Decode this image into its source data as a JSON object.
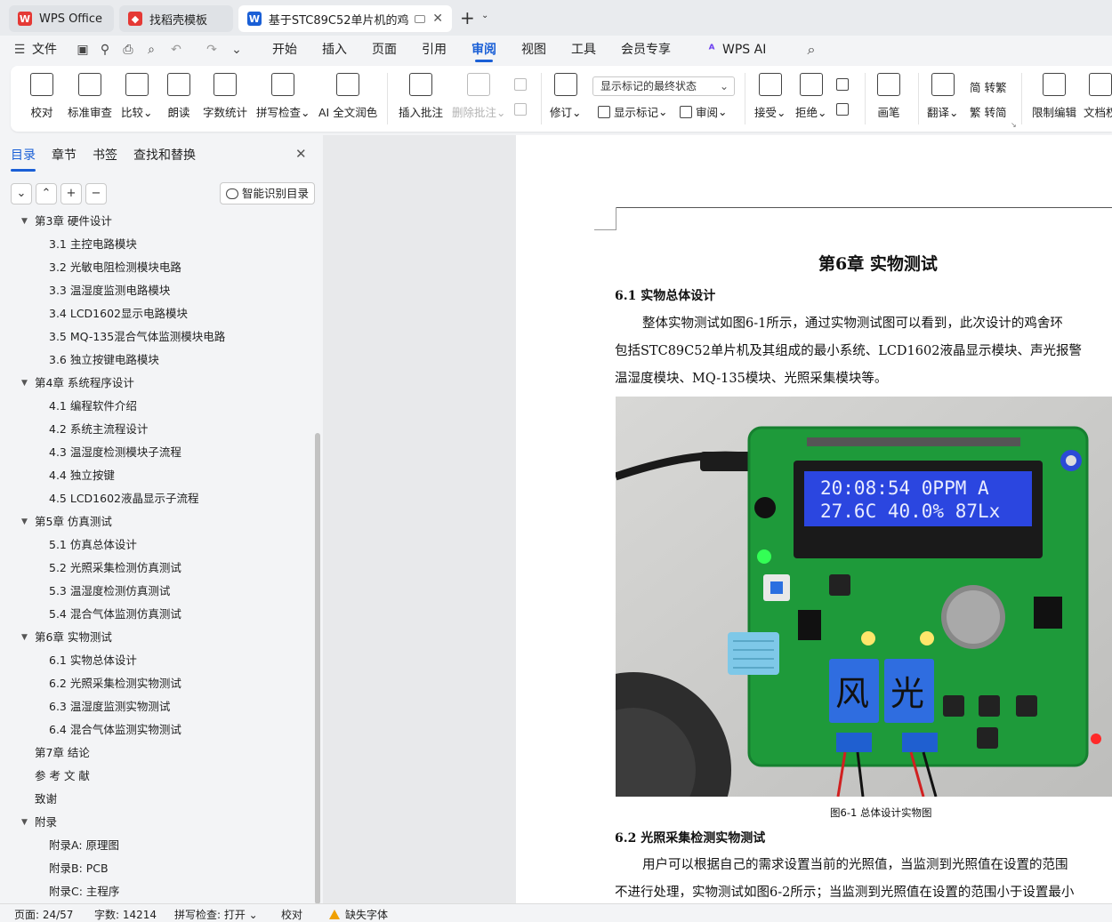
{
  "tabs": [
    {
      "label": "WPS Office",
      "logo": "W",
      "logo_color": "#e53935"
    },
    {
      "label": "找稻壳模板",
      "logo": "稻",
      "logo_color": "#e53935"
    },
    {
      "label": "基于STC89C52单片机的鸡舍环",
      "logo": "W",
      "logo_color": "#1a5fd6"
    }
  ],
  "menubar": {
    "file": "文件",
    "items": [
      "开始",
      "插入",
      "页面",
      "引用",
      "审阅",
      "视图",
      "工具",
      "会员专享",
      "WPS AI"
    ],
    "active": "审阅"
  },
  "ribbon": {
    "proofread": "校对",
    "standard_review": "标准审查",
    "compare": "比较",
    "read_aloud": "朗读",
    "word_count": "字数统计",
    "spell_check": "拼写检查",
    "ai_polish": "AI 全文润色",
    "insert_comment": "插入批注",
    "delete_comment": "删除批注",
    "track_changes": "修订",
    "markup_mode": "显示标记的最终状态",
    "show_markup": "显示标记",
    "review": "审阅",
    "accept": "接受",
    "reject": "拒绝",
    "pen": "画笔",
    "translate": "翻译",
    "to_traditional": "简 转繁",
    "to_simplified": "繁 转简",
    "restrict_edit": "限制编辑",
    "doc_permission": "文档权"
  },
  "nav": {
    "tabs": [
      "目录",
      "章节",
      "书签",
      "查找和替换"
    ],
    "active_tab": "目录",
    "smart_toc": "智能识别目录",
    "items": [
      {
        "text": "第3章  硬件设计",
        "level": 1,
        "expanded": true
      },
      {
        "text": "3.1  主控电路模块",
        "level": 2
      },
      {
        "text": "3.2  光敏电阻检测模块电路",
        "level": 2
      },
      {
        "text": "3.3  温湿度监测电路模块",
        "level": 2
      },
      {
        "text": "3.4 LCD1602显示电路模块",
        "level": 2
      },
      {
        "text": "3.5 MQ-135混合气体监测模块电路",
        "level": 2
      },
      {
        "text": "3.6  独立按键电路模块",
        "level": 2
      },
      {
        "text": "第4章  系统程序设计",
        "level": 1,
        "expanded": true
      },
      {
        "text": "4.1  编程软件介绍",
        "level": 2
      },
      {
        "text": "4.2  系统主流程设计",
        "level": 2
      },
      {
        "text": "4.3  温湿度检测模块子流程",
        "level": 2
      },
      {
        "text": "4.4  独立按键",
        "level": 2
      },
      {
        "text": "4.5 LCD1602液晶显示子流程",
        "level": 2
      },
      {
        "text": "第5章  仿真测试",
        "level": 1,
        "expanded": true
      },
      {
        "text": "5.1  仿真总体设计",
        "level": 2
      },
      {
        "text": "5.2  光照采集检测仿真测试",
        "level": 2
      },
      {
        "text": "5.3  温湿度检测仿真测试",
        "level": 2
      },
      {
        "text": "5.4  混合气体监测仿真测试",
        "level": 2
      },
      {
        "text": "第6章  实物测试",
        "level": 1,
        "expanded": true
      },
      {
        "text": "6.1  实物总体设计",
        "level": 2
      },
      {
        "text": "6.2  光照采集检测实物测试",
        "level": 2
      },
      {
        "text": "6.3  温湿度监测实物测试",
        "level": 2
      },
      {
        "text": "6.4  混合气体监测实物测试",
        "level": 2
      },
      {
        "text": "第7章  结论",
        "level": 1,
        "expanded": false
      },
      {
        "text": "参 考 文 献",
        "level": 1,
        "expanded": false
      },
      {
        "text": "致谢",
        "level": 1,
        "expanded": false
      },
      {
        "text": "附录",
        "level": 1,
        "expanded": true
      },
      {
        "text": "附录A:  原理图",
        "level": 2
      },
      {
        "text": "附录B:  PCB",
        "level": 2
      },
      {
        "text": "附录C:  主程序",
        "level": 2
      }
    ]
  },
  "document": {
    "chapter_title": "第6章  实物测试",
    "sec_6_1": "6.1  实物总体设计",
    "para1_line1": "整体实物测试如图6-1所示，通过实物测试图可以看到，此次设计的鸡舍环",
    "para1_line2": "包括STC89C52单片机及其组成的最小系统、LCD1602液晶显示模块、声光报警",
    "para1_line3": "温湿度模块、MQ-135模块、光照采集模块等。",
    "lcd_line1": "20:08:54 0PPM  A",
    "lcd_line2": "27.6C 40.0% 87Lx",
    "relay1_char": "风",
    "relay2_char": "光",
    "caption": "图6-1  总体设计实物图",
    "sec_6_2": "6.2  光照采集检测实物测试",
    "para2_line1": "用户可以根据自己的需求设置当前的光照值，当监测到光照值在设置的范围",
    "para2_line2": "不进行处理，实物测试如图6-2所示；当监测到光照值在设置的范围小于设置最小"
  },
  "status": {
    "page": "页面: 24/57",
    "words": "字数: 14214",
    "spell": "拼写检查: 打开",
    "proof": "校对",
    "missing_font": "缺失字体"
  },
  "colors": {
    "accent": "#1a5fd6",
    "pcb": "#1e9a3a",
    "lcd": "#2b46e0",
    "warning": "#f0a000"
  }
}
